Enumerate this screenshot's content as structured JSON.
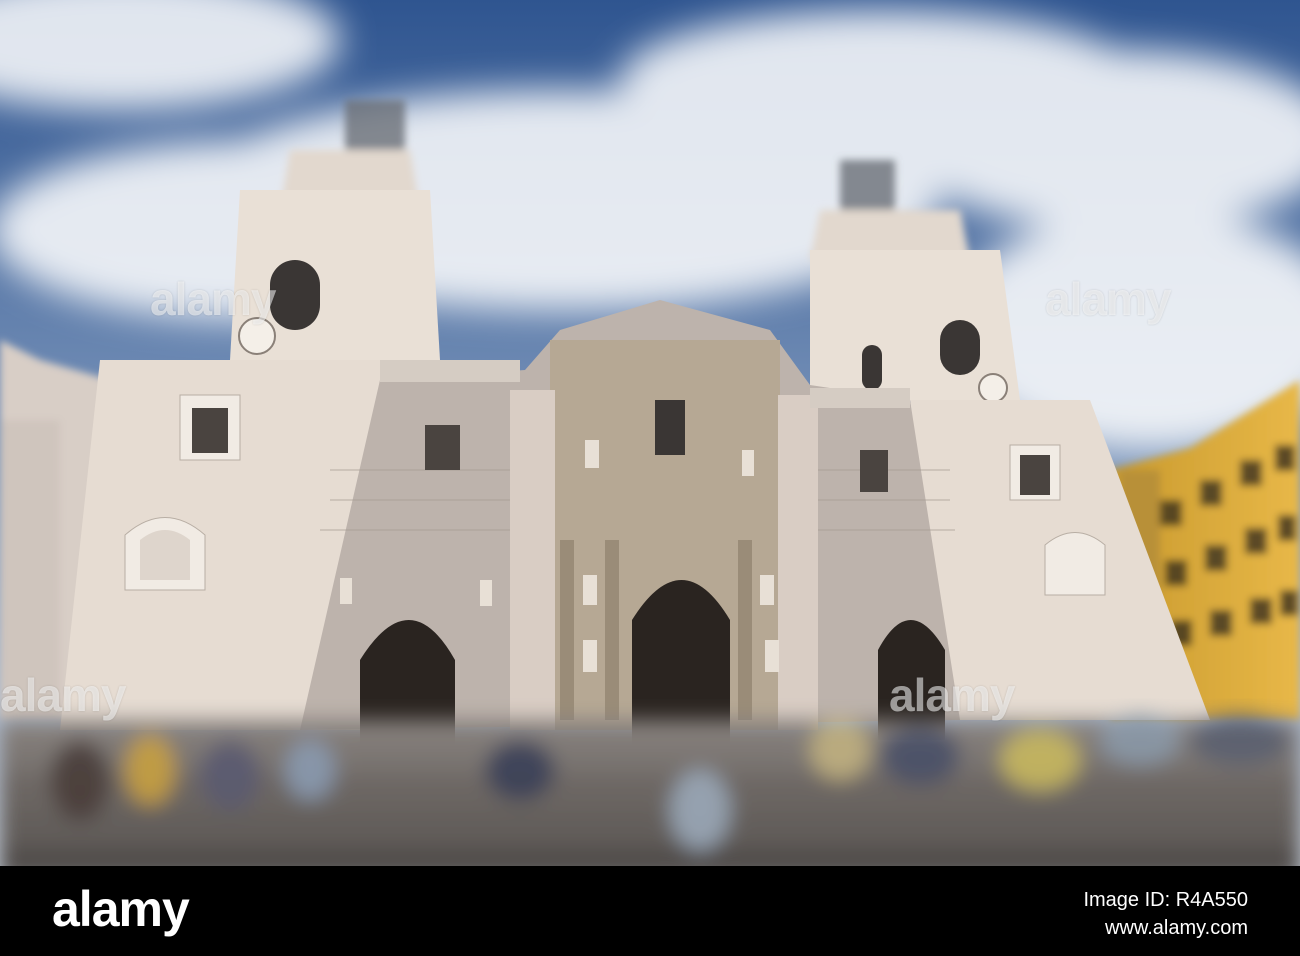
{
  "watermarks": [
    "alamy",
    "alamy",
    "alamy",
    "alamy"
  ],
  "footer": {
    "brand": "alamy",
    "image_id": "Image ID: R4A550",
    "site": "www.alamy.com"
  },
  "colors": {
    "sky": "#3f6496",
    "facade": "#e6dcd2",
    "stone": "#b4aaa8",
    "door": "#2a2420",
    "yellow_building": "#e0b040",
    "footer_bg": "#000000"
  }
}
